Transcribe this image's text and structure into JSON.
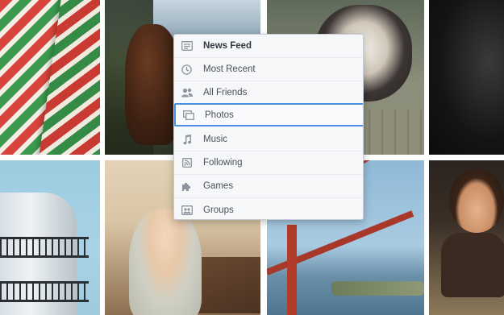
{
  "menu": {
    "items": [
      {
        "label": "News Feed",
        "icon": "news-feed-icon"
      },
      {
        "label": "Most Recent",
        "icon": "clock-icon"
      },
      {
        "label": "All Friends",
        "icon": "friends-icon"
      },
      {
        "label": "Photos",
        "icon": "photos-icon"
      },
      {
        "label": "Music",
        "icon": "music-note-icon"
      },
      {
        "label": "Following",
        "icon": "rss-feed-icon"
      },
      {
        "label": "Games",
        "icon": "puzzle-piece-icon"
      },
      {
        "label": "Groups",
        "icon": "groups-icon"
      }
    ],
    "selected_label": "Photos",
    "accent_color": "#4a90e2"
  },
  "photos": [
    {
      "subject": "striped paper"
    },
    {
      "subject": "horse"
    },
    {
      "subject": "puppy"
    },
    {
      "subject": "dark portrait"
    },
    {
      "subject": "lighthouse"
    },
    {
      "subject": "toddler with cookie"
    },
    {
      "subject": "golden gate bridge"
    },
    {
      "subject": "child"
    }
  ]
}
